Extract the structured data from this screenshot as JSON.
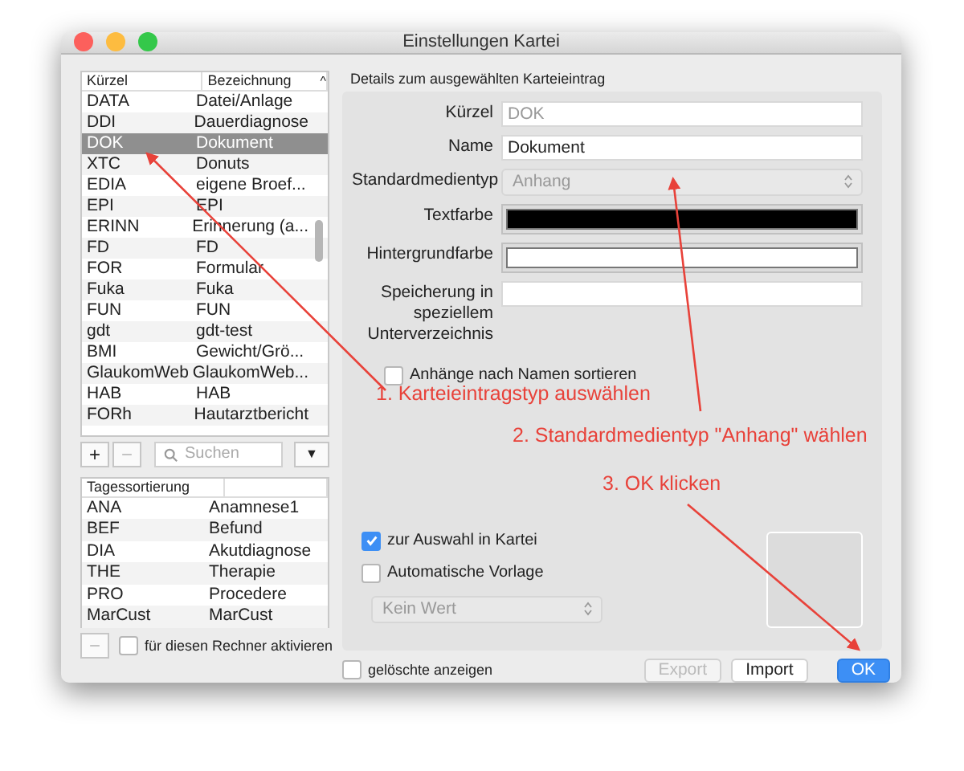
{
  "window": {
    "title": "Einstellungen Kartei"
  },
  "entry_list": {
    "columns": [
      {
        "label": "Kürzel"
      },
      {
        "label": "Bezeichnung",
        "sort_icon": "^"
      }
    ],
    "rows": [
      {
        "code": "DATA",
        "name": "Datei/Anlage",
        "selected": false
      },
      {
        "code": "DDI",
        "name": "Dauerdiagnose",
        "selected": false
      },
      {
        "code": "DOK",
        "name": "Dokument",
        "selected": true
      },
      {
        "code": "XTC",
        "name": "Donuts",
        "selected": false
      },
      {
        "code": "EDIA",
        "name": "eigene Broef...",
        "selected": false
      },
      {
        "code": "EPI",
        "name": "EPI",
        "selected": false
      },
      {
        "code": "ERINN",
        "name": "Erinnerung (a...",
        "selected": false
      },
      {
        "code": "FD",
        "name": "FD",
        "selected": false
      },
      {
        "code": "FOR",
        "name": "Formular",
        "selected": false
      },
      {
        "code": "Fuka",
        "name": "Fuka",
        "selected": false
      },
      {
        "code": "FUN",
        "name": "FUN",
        "selected": false
      },
      {
        "code": "gdt",
        "name": "gdt-test",
        "selected": false
      },
      {
        "code": "BMI",
        "name": "Gewicht/Grö...",
        "selected": false
      },
      {
        "code": "GlaukomWeb",
        "name": "GlaukomWeb...",
        "selected": false
      },
      {
        "code": "HAB",
        "name": "HAB",
        "selected": false
      },
      {
        "code": "FORh",
        "name": "Hautarztbericht",
        "selected": false
      }
    ]
  },
  "list_toolbar": {
    "add": "+",
    "remove": "−",
    "search": {
      "placeholder": "Suchen"
    },
    "menu": "▼"
  },
  "sort_list": {
    "header": "Tagessortierung",
    "rows": [
      {
        "code": "ANA",
        "name": "Anamnese1"
      },
      {
        "code": "BEF",
        "name": "Befund"
      },
      {
        "code": "DIA",
        "name": "Akutdiagnose"
      },
      {
        "code": "THE",
        "name": "Therapie"
      },
      {
        "code": "PRO",
        "name": "Procedere"
      },
      {
        "code": "MarCust",
        "name": "MarCust"
      }
    ]
  },
  "sort_toolbar": {
    "remove": "−",
    "activate": {
      "label": "für diesen Rechner aktivieren",
      "checked": false
    }
  },
  "details": {
    "title": "Details zum ausgewählten Karteieintrag",
    "fields": [
      {
        "kind": "text",
        "label": "Kürzel",
        "value": "DOK",
        "disabled": true
      },
      {
        "kind": "text",
        "label": "Name",
        "value": "Dokument"
      },
      {
        "kind": "select",
        "label": "Standardmedientyp",
        "value": "Anhang",
        "disabled": true
      },
      {
        "kind": "color",
        "label": "Textfarbe",
        "color": "#000000"
      },
      {
        "kind": "color",
        "label": "Hintergrundfarbe",
        "color": "#ffffff"
      },
      {
        "kind": "text",
        "label": "Speicherung in speziellem Unterverzeichnis"
      }
    ],
    "sort_by_name": {
      "label": "Anhänge nach Namen sortieren",
      "checked": false
    },
    "in_selection": {
      "label": "zur Auswahl in Kartei",
      "checked": true
    },
    "auto_template": {
      "label": "Automatische Vorlage",
      "checked": false
    },
    "template_select": {
      "value": "Kein Wert",
      "disabled": true
    }
  },
  "footer": {
    "show_deleted": {
      "label": "gelöschte anzeigen",
      "checked": false
    },
    "buttons": [
      {
        "label": "Export",
        "disabled": true,
        "default": false
      },
      {
        "label": "Import",
        "disabled": false,
        "default": false
      },
      {
        "label": "OK",
        "disabled": false,
        "default": true
      }
    ]
  },
  "annotations": [
    {
      "text": "1. Karteieintragstyp auswählen"
    },
    {
      "text": "2. Standardmedientyp \"Anhang\" wählen"
    },
    {
      "text": "3. OK klicken"
    }
  ]
}
